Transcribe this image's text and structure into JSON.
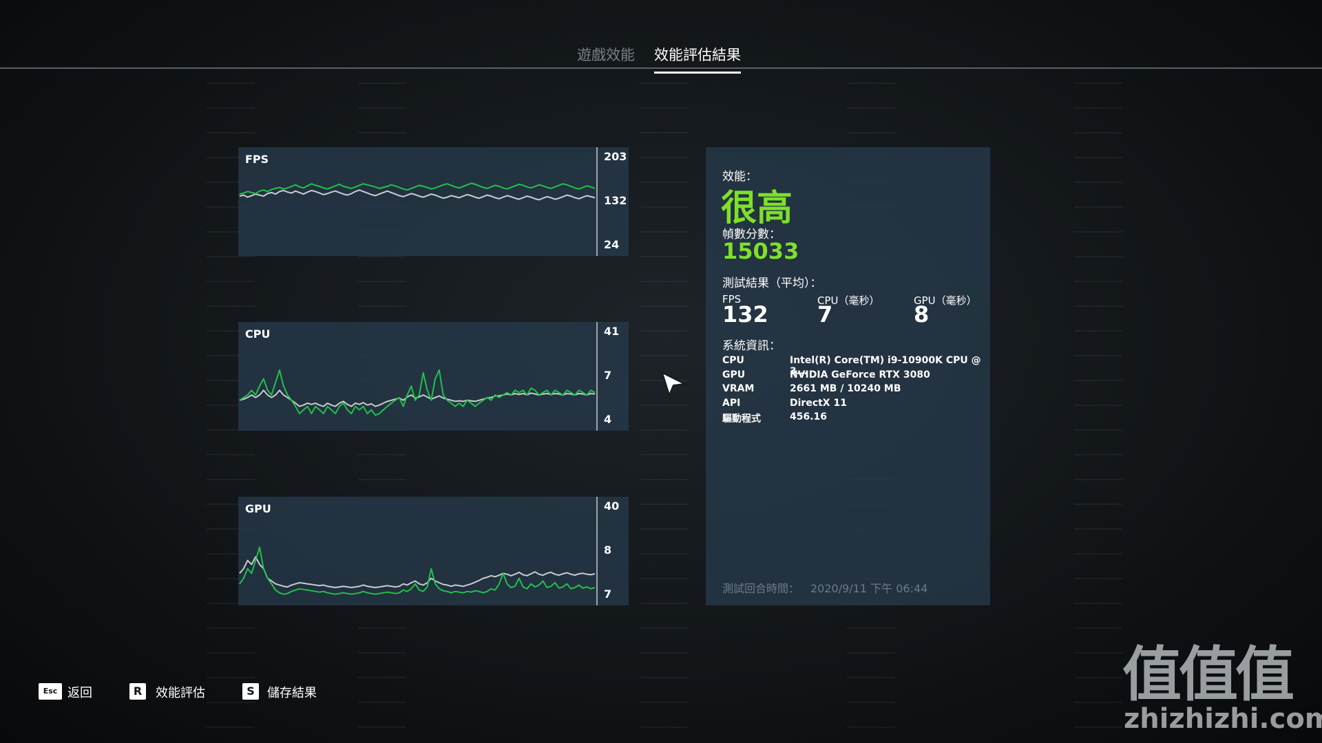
{
  "nav": {
    "tabs": [
      {
        "label": "遊戲效能",
        "active": false
      },
      {
        "label": "效能評估結果",
        "active": true
      }
    ]
  },
  "charts": [
    {
      "name": "fps",
      "label": "FPS",
      "ticks": [
        "203",
        "132",
        "24"
      ],
      "range": [
        24,
        203
      ],
      "series": [
        {
          "color": "#22c24a",
          "values": [
            128,
            130,
            133,
            131,
            129,
            134,
            136,
            133,
            137,
            139,
            141,
            138,
            140,
            143,
            146,
            142,
            140,
            144,
            148,
            145,
            143,
            140,
            138,
            141,
            144,
            147,
            143,
            141,
            139,
            142,
            145,
            148,
            146,
            144,
            142,
            139,
            141,
            143,
            146,
            144,
            141,
            138,
            136,
            139,
            142,
            145,
            143,
            141,
            138,
            140,
            143,
            146,
            148,
            145,
            142,
            140,
            143,
            146,
            149,
            147,
            144,
            141,
            139,
            142,
            145,
            143,
            140,
            138,
            141,
            144,
            147,
            145,
            142,
            140,
            143,
            146,
            144,
            141,
            139,
            142,
            145,
            148,
            146,
            143,
            140,
            138,
            141,
            144,
            142,
            139
          ]
        },
        {
          "color": "#c9cdd0",
          "values": [
            124,
            126,
            122,
            125,
            128,
            126,
            124,
            129,
            131,
            128,
            133,
            135,
            132,
            130,
            134,
            131,
            128,
            132,
            135,
            133,
            130,
            127,
            129,
            132,
            134,
            131,
            128,
            126,
            129,
            133,
            136,
            133,
            130,
            127,
            125,
            128,
            131,
            134,
            131,
            128,
            125,
            123,
            126,
            129,
            127,
            124,
            122,
            125,
            128,
            126,
            123,
            120,
            122,
            125,
            123,
            121,
            124,
            127,
            125,
            122,
            120,
            123,
            126,
            124,
            121,
            119,
            122,
            125,
            123,
            120,
            118,
            121,
            124,
            122,
            119,
            117,
            120,
            123,
            121,
            118,
            120,
            123,
            126,
            124,
            121,
            119,
            122,
            125,
            123,
            121
          ]
        }
      ]
    },
    {
      "name": "cpu",
      "label": "CPU",
      "ticks": [
        "41",
        "7",
        "4"
      ],
      "range": [
        4,
        41
      ],
      "series": [
        {
          "color": "#22c24a",
          "values": [
            7,
            7.5,
            8,
            9,
            8,
            10,
            12,
            9,
            8,
            11,
            15,
            10,
            8,
            7,
            6,
            5,
            5.5,
            6,
            5,
            6,
            5.5,
            5,
            6,
            5.5,
            5,
            6,
            6.5,
            5.5,
            5,
            6,
            5.5,
            6,
            5,
            5.5,
            4.8,
            5,
            5.5,
            6,
            6.5,
            7,
            7.5,
            6,
            8,
            10,
            7,
            8,
            14,
            9,
            7,
            12,
            15,
            8,
            7,
            6.5,
            6,
            6.5,
            6,
            7,
            6.5,
            6,
            6.5,
            7,
            7.5,
            7,
            8,
            7.5,
            8,
            8.5,
            8,
            9,
            8.5,
            9,
            8,
            9.5,
            9,
            8,
            8.5,
            9,
            8,
            9,
            8.5,
            8,
            9,
            8.5,
            8,
            9,
            8.5,
            8,
            9,
            8.5
          ]
        },
        {
          "color": "#c9cdd0",
          "values": [
            7,
            7.2,
            7.5,
            8,
            7.5,
            8,
            9,
            8,
            7.5,
            8,
            9,
            8,
            7.5,
            7,
            6.5,
            6,
            6.2,
            6.5,
            6.3,
            6.5,
            6.2,
            6,
            6.5,
            6.2,
            6,
            6.5,
            6.8,
            6.3,
            6,
            6.5,
            6.3,
            6.6,
            6.2,
            6.4,
            6,
            6.2,
            6.5,
            6.8,
            7,
            7.2,
            7.4,
            7,
            7.6,
            8,
            7.4,
            7.6,
            8,
            7.6,
            7.2,
            7.5,
            7.8,
            7.4,
            7.2,
            7,
            6.8,
            6.9,
            6.8,
            7,
            6.9,
            6.8,
            7,
            7.2,
            7.4,
            7.5,
            7.8,
            7.8,
            8,
            8.2,
            8,
            8.3,
            8.1,
            8.3,
            8,
            8.4,
            8.2,
            8,
            8.2,
            8.3,
            8.1,
            8.3,
            8.2,
            8,
            8.3,
            8.2,
            8,
            8.3,
            8.2,
            8,
            8.3,
            8.2
          ]
        }
      ]
    },
    {
      "name": "gpu",
      "label": "GPU",
      "ticks": [
        "40",
        "8",
        "7"
      ],
      "range": [
        7,
        40
      ],
      "series": [
        {
          "color": "#22c24a",
          "values": [
            9,
            10,
            12,
            11,
            14,
            18,
            12,
            10,
            9,
            8,
            7.6,
            7.4,
            7.5,
            7.8,
            8,
            8.2,
            8.1,
            8,
            7.9,
            7.8,
            7.7,
            7.8,
            7.6,
            7.5,
            7.4,
            7.5,
            7.6,
            7.5,
            7.4,
            7.5,
            7.6,
            7.8,
            7.6,
            7.5,
            7.4,
            7.5,
            7.6,
            7.7,
            7.6,
            7.5,
            7.6,
            8,
            7.8,
            8.2,
            9,
            8,
            7.8,
            8.5,
            12,
            9,
            8.2,
            7.9,
            7.8,
            7.6,
            7.8,
            7.7,
            7.6,
            7.8,
            7.7,
            7.9,
            7.8,
            7.6,
            7.8,
            8.2,
            8,
            9,
            11,
            9,
            8.4,
            8.6,
            10,
            8.5,
            8.2,
            9,
            8.5,
            8.8,
            9.5,
            8.4,
            8.6,
            9.2,
            8.3,
            8.5,
            9,
            8.2,
            8.4,
            8.8,
            8.3,
            8.5,
            8.2,
            8.4
          ]
        },
        {
          "color": "#c9cdd0",
          "values": [
            11,
            12,
            14,
            13,
            15,
            13,
            12,
            10,
            9.5,
            9,
            8.8,
            8.6,
            8.5,
            8.8,
            9,
            9.2,
            9.1,
            9,
            8.9,
            8.8,
            8.7,
            8.8,
            8.6,
            8.5,
            8.4,
            8.5,
            8.6,
            8.5,
            8.4,
            8.5,
            8.6,
            8.8,
            8.6,
            8.5,
            8.4,
            8.5,
            8.6,
            8.7,
            8.6,
            8.5,
            8.6,
            9,
            8.8,
            9.2,
            9.5,
            9,
            8.8,
            9.2,
            10,
            9.5,
            9.2,
            8.9,
            8.8,
            8.6,
            8.8,
            8.7,
            8.6,
            8.8,
            9,
            9.3,
            9.6,
            10,
            10.2,
            10.5,
            10.3,
            10.6,
            11,
            10.8,
            10.5,
            10.8,
            11.2,
            10.7,
            10.5,
            10.9,
            11.3,
            10.8,
            10.6,
            11,
            11.2,
            10.8,
            10.6,
            10.9,
            11.1,
            10.8,
            10.6,
            10.9,
            11,
            10.8,
            10.7,
            10.9
          ]
        }
      ]
    }
  ],
  "results": {
    "perf_label": "效能：",
    "perf_value": "很高",
    "score_label": "幀數分數：",
    "score_value": "15033",
    "avg_label": "測試結果（平均）：",
    "fps_label": "FPS",
    "fps_value": "132",
    "cpu_label": "CPU（毫秒）",
    "cpu_value": "7",
    "gpu_label": "GPU（毫秒）",
    "gpu_value": "8",
    "sys_label": "系統資訊：",
    "sys": [
      {
        "key": "CPU",
        "value": "Intel(R) Core(TM) i9-10900K CPU @ 3..."
      },
      {
        "key": "GPU",
        "value": "NVIDIA GeForce RTX 3080"
      },
      {
        "key": "VRAM",
        "value": "2661 MB / 10240 MB"
      },
      {
        "key": "API",
        "value": "DirectX 11"
      },
      {
        "key": "驅動程式",
        "value": "456.16"
      }
    ],
    "timestamp_label": "測試回合時間：",
    "timestamp_value": "2020/9/11 下午 06:44"
  },
  "footer": {
    "back_key": "Esc",
    "back_label": "返回",
    "bench_key": "R",
    "bench_label": "效能評估",
    "save_key": "S",
    "save_label": "儲存結果"
  },
  "watermark": {
    "glyphs": "值值值",
    "domain": "zhizhizhi.com"
  }
}
